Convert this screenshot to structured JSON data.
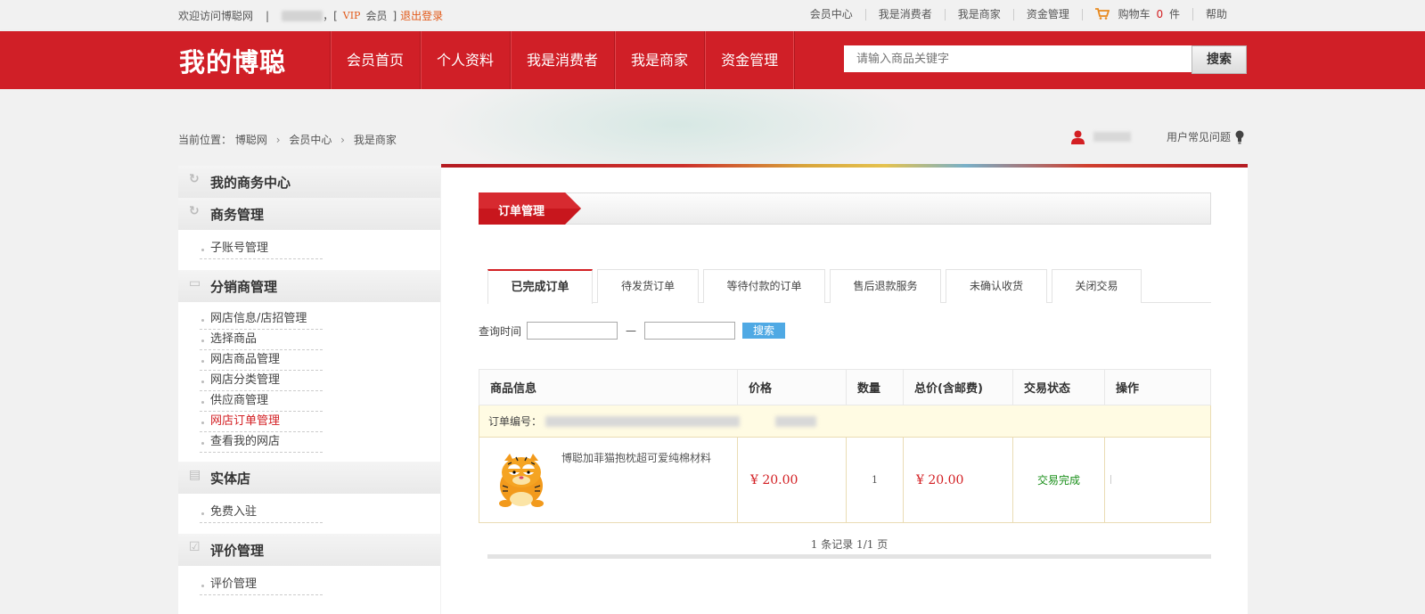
{
  "topbar": {
    "welcome": "欢迎访问博聪网",
    "separator": "|",
    "vip_prefix": "[",
    "vip_tag": "VIP",
    "member_label": "会员",
    "vip_suffix": "]",
    "logout": "退出登录",
    "links": [
      "会员中心",
      "我是消费者",
      "我是商家",
      "资金管理"
    ],
    "cart_label": "购物车",
    "cart_count": "0",
    "cart_unit": "件",
    "help": "帮助"
  },
  "nav": {
    "logo": "我的博聪",
    "menu": [
      "会员首页",
      "个人资料",
      "我是消费者",
      "我是商家",
      "资金管理"
    ],
    "search_placeholder": "请输入商品关键字",
    "search_button": "搜索"
  },
  "breadcrumb": {
    "prefix": "当前位置：",
    "items": [
      "博聪网",
      "会员中心",
      "我是商家"
    ],
    "faq": "用户常见问题"
  },
  "sidebar": {
    "sections": [
      {
        "title": "我的商务中心",
        "icon": "refresh-icon",
        "items": []
      },
      {
        "title": "商务管理",
        "icon": "refresh-icon",
        "items": [
          "子账号管理"
        ]
      },
      {
        "title": "分销商管理",
        "icon": "card-icon",
        "items": [
          "网店信息/店招管理",
          "选择商品",
          "网店商品管理",
          "网店分类管理",
          "供应商管理",
          "网店订单管理",
          "查看我的网店"
        ]
      },
      {
        "title": "实体店",
        "icon": "store-icon",
        "items": [
          "免费入驻"
        ]
      },
      {
        "title": "评价管理",
        "icon": "checkbox-icon",
        "items": [
          "评价管理"
        ]
      }
    ],
    "active_item": "网店订单管理"
  },
  "main": {
    "section_title": "订单管理",
    "tabs": [
      "已完成订单",
      "待发货订单",
      "等待付款的订单",
      "售后退款服务",
      "未确认收货",
      "关闭交易"
    ],
    "active_tab": "已完成订单",
    "query_label": "查询时间",
    "query_dash": "—",
    "query_button": "搜索",
    "table": {
      "headers": [
        "商品信息",
        "价格",
        "数量",
        "总价(含邮费)",
        "交易状态",
        "操作"
      ],
      "order_no_label": "订单编号：",
      "rows": [
        {
          "name": "博聪加菲猫抱枕超可爱纯棉材料",
          "price": "¥ 20.00",
          "qty": "1",
          "total": "¥ 20.00",
          "status": "交易完成",
          "action": ""
        }
      ]
    },
    "pager": "1 条记录 1/1 页"
  },
  "colors": {
    "brand_red": "#d01f27",
    "accent_blue": "#4fa9e4",
    "status_green": "#1a8f1a"
  }
}
